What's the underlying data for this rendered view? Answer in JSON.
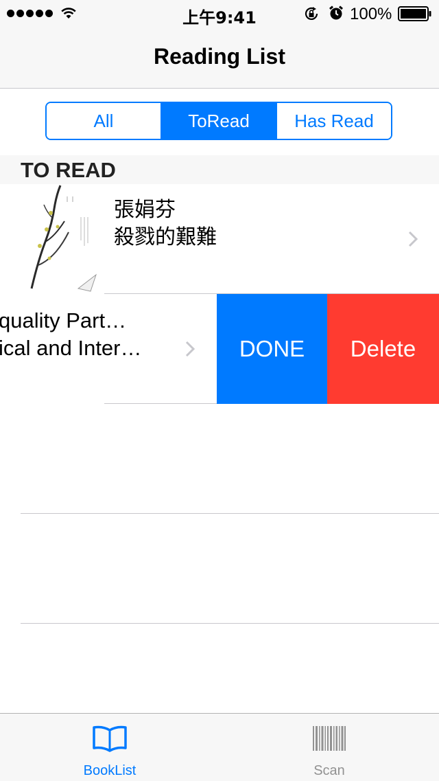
{
  "status_bar": {
    "time": "上午9:41",
    "battery_percent": "100%"
  },
  "nav": {
    "title": "Reading List"
  },
  "segmented_control": {
    "segments": [
      "All",
      "ToRead",
      "Has Read"
    ],
    "selected": "ToRead"
  },
  "section": {
    "title": "TO READ"
  },
  "rows": [
    {
      "title": "張娟芬",
      "subtitle": "殺戮的艱難"
    },
    {
      "title": "quality Part…",
      "subtitle": "ical and Inter…",
      "actions": {
        "done_label": "DONE",
        "delete_label": "Delete"
      }
    }
  ],
  "tab_bar": {
    "tabs": [
      {
        "label": "BookList",
        "icon": "book-icon",
        "selected": true
      },
      {
        "label": "Scan",
        "icon": "barcode-icon",
        "selected": false
      }
    ]
  },
  "colors": {
    "accent": "#007aff",
    "delete": "#ff3b30",
    "separator": "#c8c7cc",
    "bar_background": "#f7f7f7",
    "inactive_tab": "#929292"
  }
}
